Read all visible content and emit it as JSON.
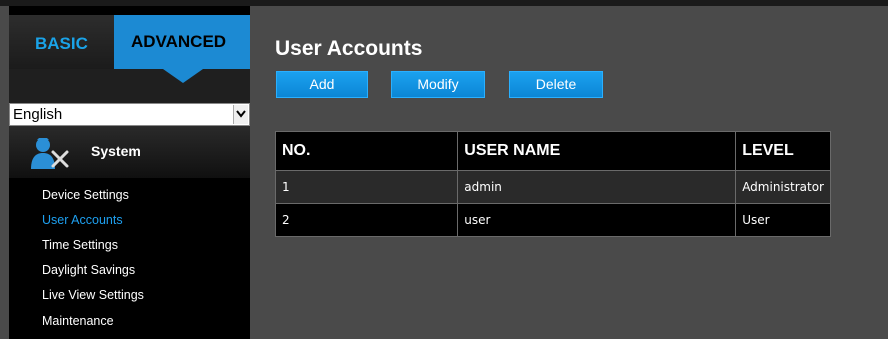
{
  "sidebar": {
    "tabs": {
      "basic": "BASIC",
      "advanced": "ADVANCED"
    },
    "language": {
      "selected": "English"
    },
    "section": {
      "title": "System",
      "icon": "system-admin-icon"
    },
    "menu": [
      {
        "label": "Device Settings",
        "active": false
      },
      {
        "label": "User Accounts",
        "active": true
      },
      {
        "label": "Time Settings",
        "active": false
      },
      {
        "label": "Daylight Savings",
        "active": false
      },
      {
        "label": "Live View Settings",
        "active": false
      },
      {
        "label": "Maintenance",
        "active": false
      }
    ]
  },
  "main": {
    "title": "User Accounts",
    "buttons": {
      "add": "Add",
      "modify": "Modify",
      "delete": "Delete"
    },
    "table": {
      "headers": [
        "NO.",
        "USER NAME",
        "LEVEL"
      ],
      "rows": [
        [
          "1",
          "admin",
          "Administrator"
        ],
        [
          "2",
          "user",
          "User"
        ]
      ]
    }
  },
  "colors": {
    "accent": "#1c8ad3",
    "active_link": "#1ea0f0",
    "background": "#4a4a4a"
  }
}
